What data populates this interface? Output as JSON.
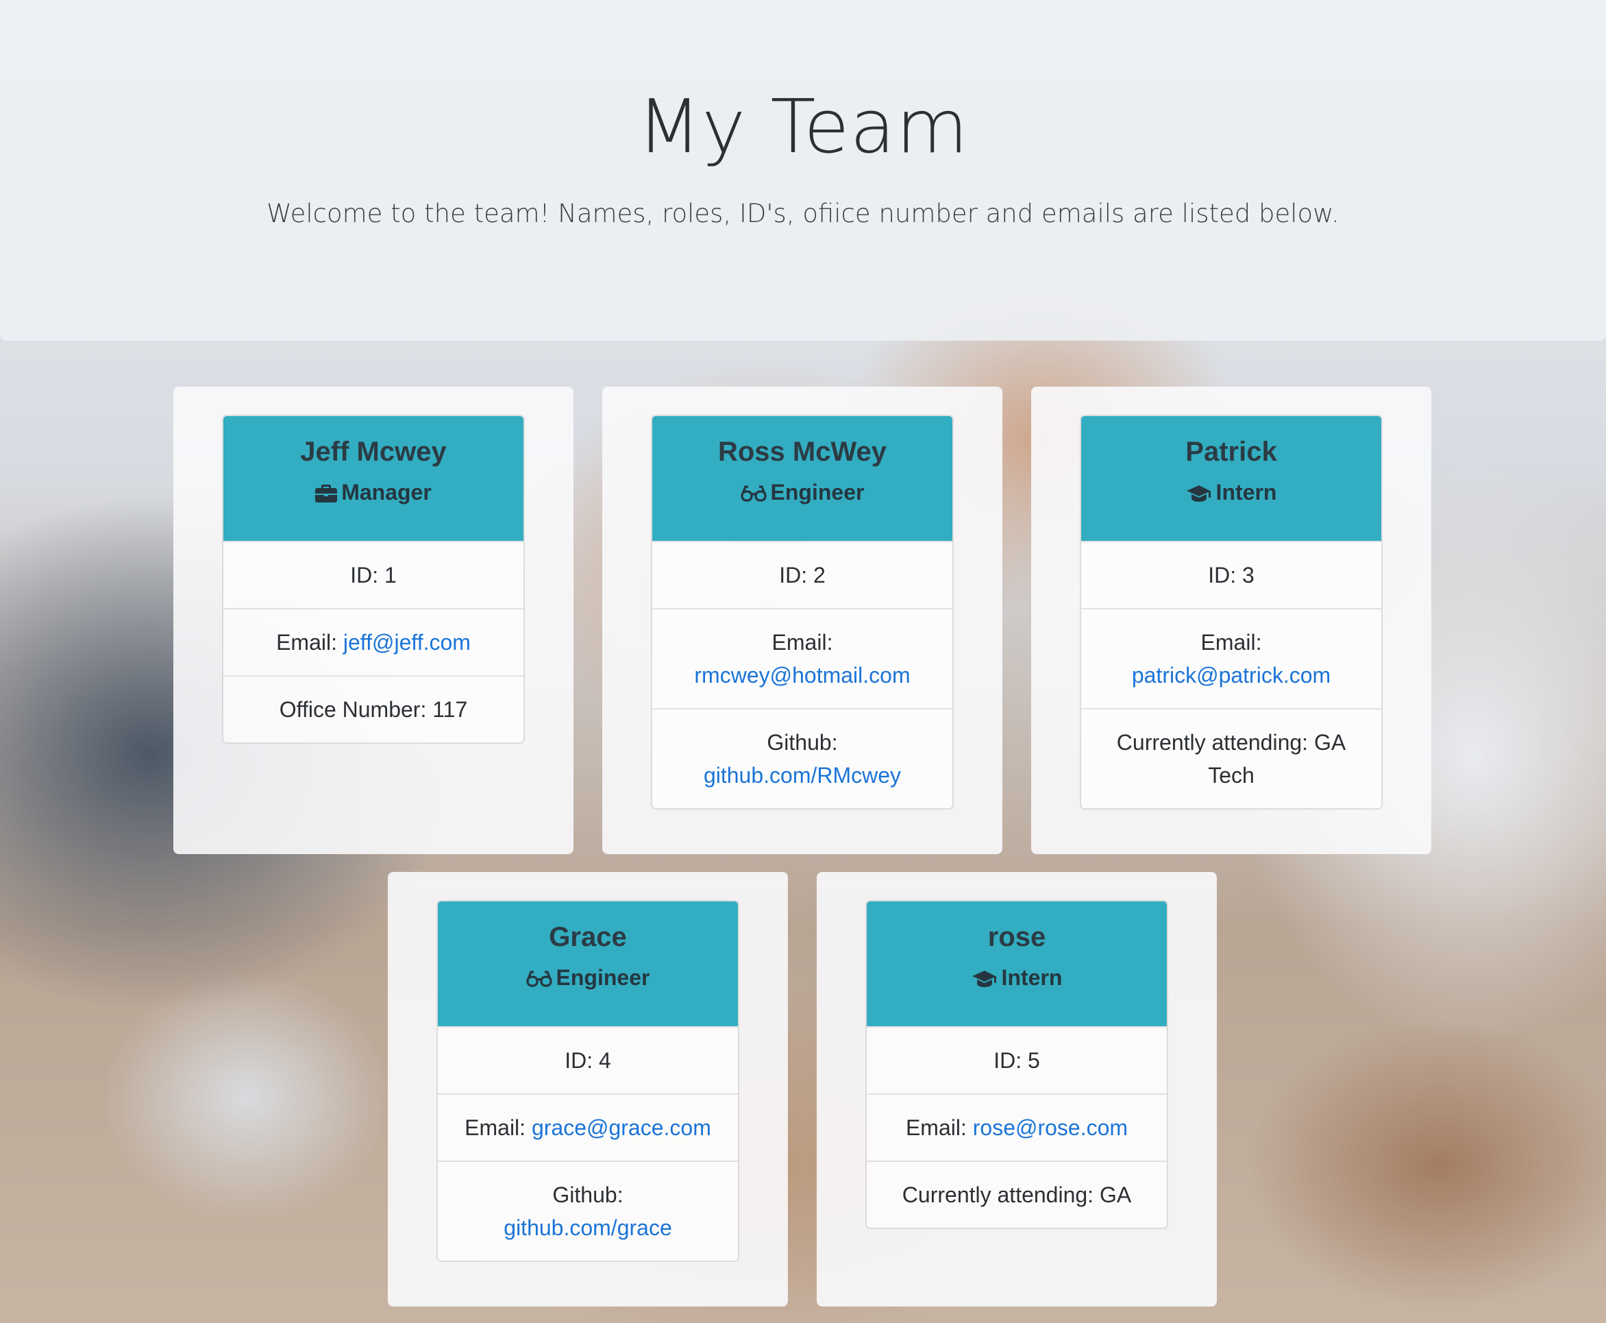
{
  "header": {
    "title": "My Team",
    "subtitle": "Welcome to the team! Names, roles, ID's, ofiice number and emails are listed below."
  },
  "colors": {
    "card_header": "#17a2b8",
    "link": "#1b74d8"
  },
  "members": [
    {
      "name": "Jeff Mcwey",
      "role": "Manager",
      "role_icon": "briefcase-icon",
      "id": "ID: 1",
      "email_label": "Email:",
      "email": "jeff@jeff.com",
      "extra_label": "Office Number: 117",
      "extra_link": ""
    },
    {
      "name": "Ross McWey",
      "role": "Engineer",
      "role_icon": "glasses-icon",
      "id": "ID: 2",
      "email_label": "Email:",
      "email": "rmcwey@hotmail.com",
      "extra_label": "Github:",
      "extra_link": "github.com/RMcwey"
    },
    {
      "name": "Patrick",
      "role": "Intern",
      "role_icon": "graduation-cap-icon",
      "id": "ID: 3",
      "email_label": "Email:",
      "email": "patrick@patrick.com",
      "extra_label": "Currently attending: GA Tech",
      "extra_link": ""
    },
    {
      "name": "Grace",
      "role": "Engineer",
      "role_icon": "glasses-icon",
      "id": "ID: 4",
      "email_label": "Email:",
      "email": "grace@grace.com",
      "extra_label": "Github:",
      "extra_link": "github.com/grace"
    },
    {
      "name": "rose",
      "role": "Intern",
      "role_icon": "graduation-cap-icon",
      "id": "ID: 5",
      "email_label": "Email:",
      "email": "rose@rose.com",
      "extra_label": "Currently attending: GA",
      "extra_link": ""
    }
  ]
}
